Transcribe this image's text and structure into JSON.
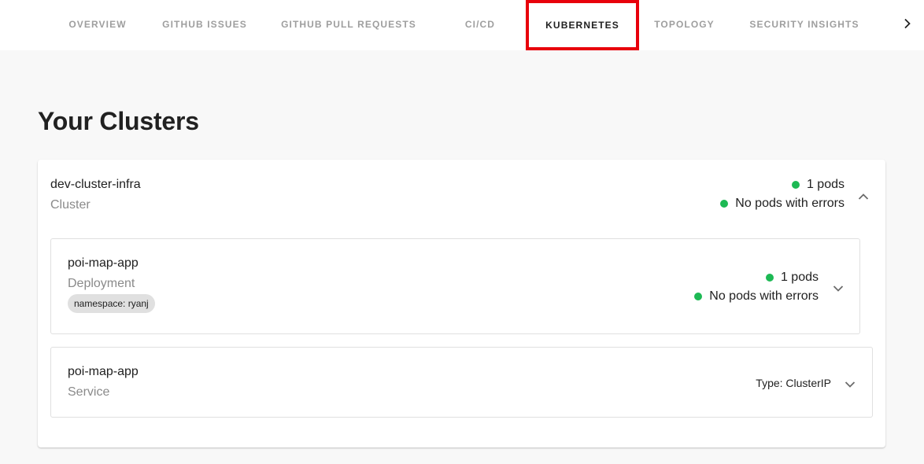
{
  "tabs": [
    {
      "label": "Overview",
      "active": false
    },
    {
      "label": "GitHub Issues",
      "active": false
    },
    {
      "label": "GitHub Pull Requests",
      "active": false
    },
    {
      "label": "CI/CD",
      "active": false
    },
    {
      "label": "Kubernetes",
      "active": true
    },
    {
      "label": "Topology",
      "active": false
    },
    {
      "label": "Security Insights",
      "active": false
    }
  ],
  "page": {
    "title": "Your Clusters"
  },
  "cluster": {
    "name": "dev-cluster-infra",
    "kind": "Cluster",
    "pods": "1 pods",
    "errors": "No pods with errors",
    "expanded": true
  },
  "deployment": {
    "name": "poi-map-app",
    "kind": "Deployment",
    "namespace": "namespace: ryanj",
    "pods": "1 pods",
    "errors": "No pods with errors"
  },
  "service": {
    "name": "poi-map-app",
    "kind": "Service",
    "type": "Type: ClusterIP"
  },
  "colors": {
    "active_highlight": "#e8000b",
    "status_ok": "#1db954"
  },
  "icons": {
    "tab_next": "chevron-right-icon",
    "collapse": "chevron-up-icon",
    "expand": "chevron-down-icon",
    "status": "status-dot-icon"
  }
}
